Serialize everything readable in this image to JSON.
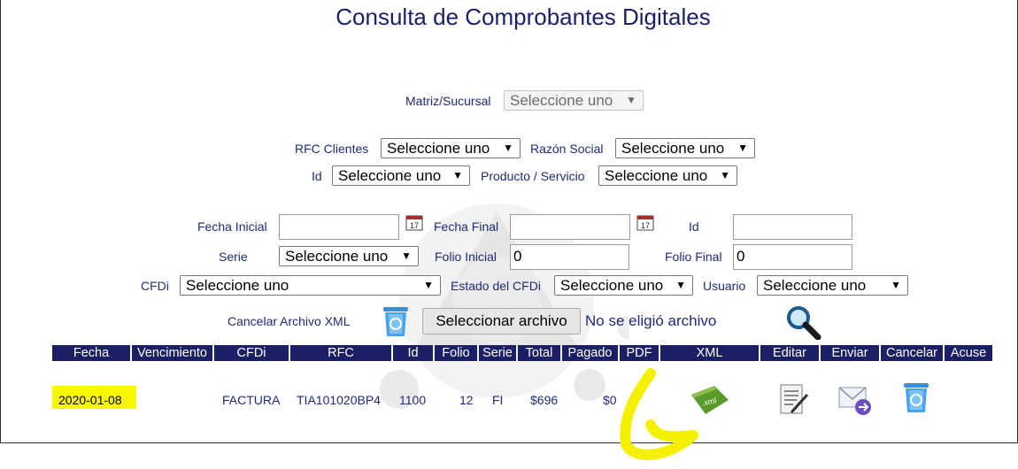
{
  "page": {
    "title": "Consulta de Comprobantes Digitales"
  },
  "filters": {
    "matriz_label": "Matriz/Sucursal",
    "matriz_value": "Seleccione uno",
    "rfc_label": "RFC Clientes",
    "rfc_value": "Seleccione uno",
    "razon_label": "Razón Social",
    "razon_value": "Seleccione uno",
    "id_label": "Id",
    "id_value": "Seleccione uno",
    "producto_label": "Producto / Servicio",
    "producto_value": "Seleccione uno",
    "fecha_inicial_label": "Fecha Inicial",
    "fecha_inicial_value": "",
    "fecha_final_label": "Fecha Final",
    "fecha_final_value": "",
    "id2_label": "Id",
    "id2_value": "",
    "serie_label": "Serie",
    "serie_value": "Seleccione uno",
    "folio_inicial_label": "Folio Inicial",
    "folio_inicial_value": "0",
    "folio_final_label": "Folio Final",
    "folio_final_value": "0",
    "cfdi_label": "CFDi",
    "cfdi_value": "Seleccione uno",
    "estado_label": "Estado del CFDi",
    "estado_value": "Seleccione uno",
    "usuario_label": "Usuario",
    "usuario_value": "Seleccione uno",
    "cancelar_xml_label": "Cancelar Archivo XML",
    "file_button": "Seleccionar archivo",
    "file_status": "No se eligió archivo"
  },
  "table": {
    "columns": [
      "Fecha",
      "Vencimiento",
      "CFDi",
      "RFC",
      "Id",
      "Folio",
      "Serie",
      "Total",
      "Pagado",
      "PDF",
      "XML",
      "Editar",
      "Enviar",
      "Cancelar",
      "Acuse"
    ],
    "rows": [
      {
        "fecha": "2020-01-08",
        "vencimiento": "",
        "cfdi": "FACTURA",
        "rfc": "TIA101020BP4",
        "id": "1100",
        "folio": "12",
        "serie": "FI",
        "total": "$696",
        "pagado": "$0",
        "xml_icon": "xml-file-icon",
        "xml_badge": ".xml"
      }
    ]
  },
  "colors": {
    "header": "#1b1f66",
    "label": "#1f2b7a",
    "highlight": "#f7f700"
  }
}
